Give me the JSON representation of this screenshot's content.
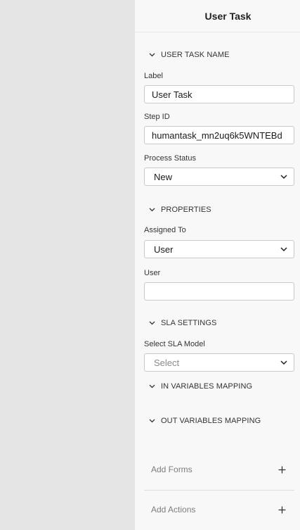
{
  "panel": {
    "title": "User Task"
  },
  "sections": {
    "user_task_name": "USER TASK NAME",
    "properties": "PROPERTIES",
    "sla_settings": "SLA SETTINGS",
    "in_variables": "IN VARIABLES MAPPING",
    "out_variables": "OUT VARIABLES MAPPING"
  },
  "fields": {
    "label": {
      "label": "Label",
      "value": "User Task"
    },
    "step_id": {
      "label": "Step ID",
      "value": "humantask_mn2uq6k5WNTEBd"
    },
    "process_status": {
      "label": "Process Status",
      "value": "New"
    },
    "assigned_to": {
      "label": "Assigned To",
      "value": "User"
    },
    "user": {
      "label": "User",
      "value": ""
    },
    "sla_model": {
      "label": "Select SLA Model",
      "placeholder": "Select"
    }
  },
  "actions": {
    "add_forms": "Add Forms",
    "add_actions": "Add Actions"
  }
}
